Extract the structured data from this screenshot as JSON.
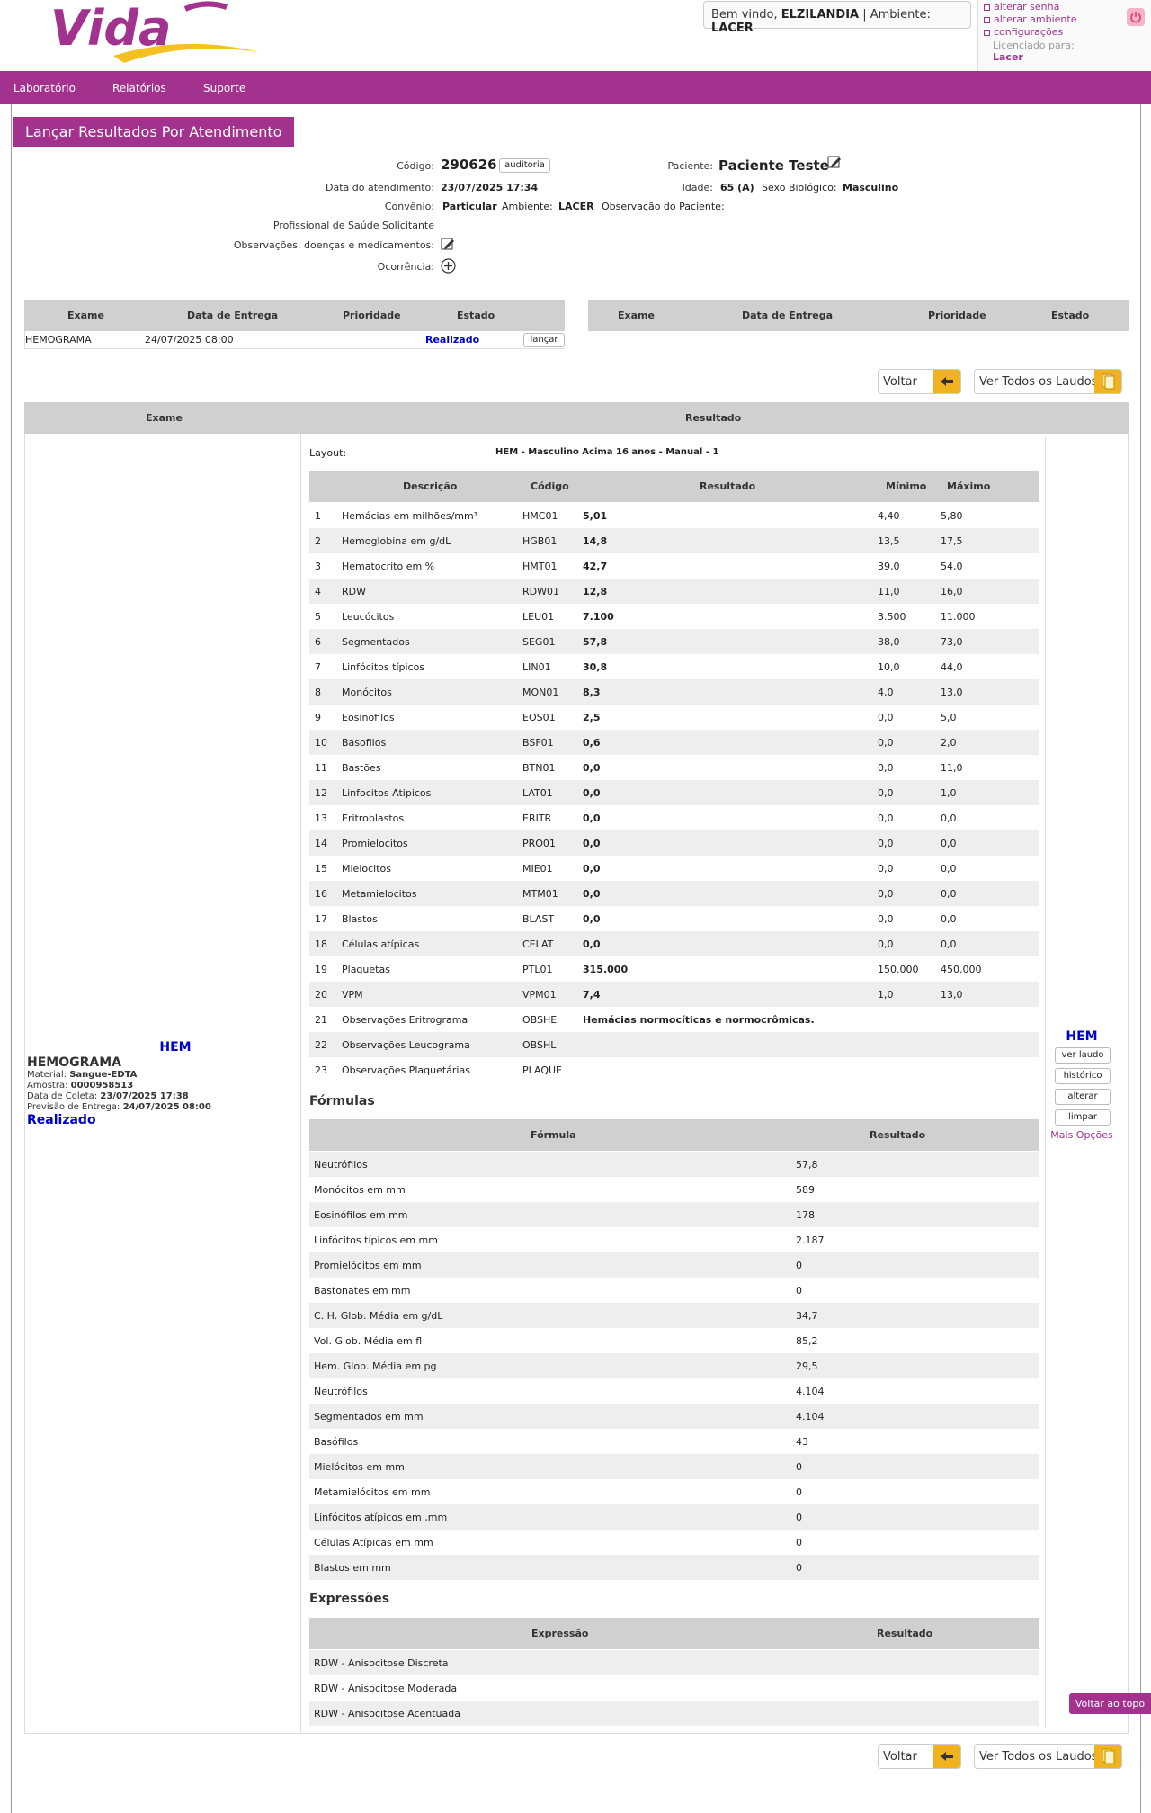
{
  "header": {
    "welcome_prefix": "Bem vindo,",
    "user": "ELZILANDIA",
    "env_prefix": "| Ambiente:",
    "env": "LACER",
    "links": [
      "alterar senha",
      "alterar ambiente",
      "configurações"
    ],
    "licensed_label": "Licenciado para:",
    "licensed_to": "Lacer"
  },
  "nav": [
    "Laboratório",
    "Relatórios",
    "Suporte"
  ],
  "page_title": "Lançar Resultados Por Atendimento",
  "info": {
    "codigo_label": "Código:",
    "codigo": "290626",
    "auditoria_btn": "auditoria",
    "data_label": "Data do atendimento:",
    "data": "23/07/2025 17:34",
    "convenio_label": "Convênio:",
    "convenio": "Particular",
    "ambiente_label": "Ambiente:",
    "ambiente": "LACER",
    "obs_paciente_label": "Observação do Paciente:",
    "profissional_label": "Profissional de Saúde Solicitante",
    "observacoes_label": "Observações, doenças e medicamentos:",
    "ocorrencia_label": "Ocorrência:",
    "paciente_label": "Paciente:",
    "paciente": "Paciente Teste",
    "idade_label": "Idade:",
    "idade": "65 (A)",
    "sexo_label": "Sexo Biológico:",
    "sexo": "Masculino"
  },
  "exam_table": {
    "headers": [
      "Exame",
      "Data de Entrega",
      "Prioridade",
      "Estado"
    ],
    "row": {
      "exame": "HEMOGRAMA",
      "data": "24/07/2025 08:00",
      "estado": "Realizado",
      "btn": "lançar"
    }
  },
  "buttons": {
    "voltar": "Voltar",
    "ver_todos": "Ver Todos os Laudos",
    "voltar_topo": "Voltar ao topo"
  },
  "result_head": {
    "exame": "Exame",
    "resultado": "Resultado"
  },
  "exam_info": {
    "code": "HEM",
    "name": "HEMOGRAMA",
    "material_label": "Material:",
    "material": "Sangue-EDTA",
    "amostra_label": "Amostra:",
    "amostra": "0000958513",
    "coleta_label": "Data de Coleta:",
    "coleta": "23/07/2025 17:38",
    "previsao_label": "Previsão de Entrega:",
    "previsao": "24/07/2025 08:00",
    "status": "Realizado"
  },
  "layout": {
    "label": "Layout:",
    "value": "HEM - Masculino Acima 16 anos - Manual - 1"
  },
  "params_headers": [
    "Descrição",
    "Código",
    "Resultado",
    "Mínimo",
    "Máximo"
  ],
  "params": [
    {
      "n": "1",
      "desc": "Hemácias em milhões/mm³",
      "code": "HMC01",
      "res": "5,01",
      "min": "4,40",
      "max": "5,80"
    },
    {
      "n": "2",
      "desc": "Hemoglobina em g/dL",
      "code": "HGB01",
      "res": "14,8",
      "min": "13,5",
      "max": "17,5"
    },
    {
      "n": "3",
      "desc": "Hematocrito em %",
      "code": "HMT01",
      "res": "42,7",
      "min": "39,0",
      "max": "54,0"
    },
    {
      "n": "4",
      "desc": "RDW",
      "code": "RDW01",
      "res": "12,8",
      "min": "11,0",
      "max": "16,0"
    },
    {
      "n": "5",
      "desc": "Leucócitos",
      "code": "LEU01",
      "res": "7.100",
      "min": "3.500",
      "max": "11.000"
    },
    {
      "n": "6",
      "desc": "Segmentados",
      "code": "SEG01",
      "res": "57,8",
      "min": "38,0",
      "max": "73,0"
    },
    {
      "n": "7",
      "desc": "Linfócitos típicos",
      "code": "LIN01",
      "res": "30,8",
      "min": "10,0",
      "max": "44,0"
    },
    {
      "n": "8",
      "desc": "Monócitos",
      "code": "MON01",
      "res": "8,3",
      "min": "4,0",
      "max": "13,0"
    },
    {
      "n": "9",
      "desc": "Eosinofilos",
      "code": "EOS01",
      "res": "2,5",
      "min": "0,0",
      "max": "5,0"
    },
    {
      "n": "10",
      "desc": "Basofilos",
      "code": "BSF01",
      "res": "0,6",
      "min": "0,0",
      "max": "2,0"
    },
    {
      "n": "11",
      "desc": "Bastões",
      "code": "BTN01",
      "res": "0,0",
      "min": "0,0",
      "max": "11,0"
    },
    {
      "n": "12",
      "desc": "Linfocitos Atipicos",
      "code": "LAT01",
      "res": "0,0",
      "min": "0,0",
      "max": "1,0"
    },
    {
      "n": "13",
      "desc": "Eritroblastos",
      "code": "ERITR",
      "res": "0,0",
      "min": "0,0",
      "max": "0,0"
    },
    {
      "n": "14",
      "desc": "Promielocitos",
      "code": "PRO01",
      "res": "0,0",
      "min": "0,0",
      "max": "0,0"
    },
    {
      "n": "15",
      "desc": "Mielocitos",
      "code": "MIE01",
      "res": "0,0",
      "min": "0,0",
      "max": "0,0"
    },
    {
      "n": "16",
      "desc": "Metamielocitos",
      "code": "MTM01",
      "res": "0,0",
      "min": "0,0",
      "max": "0,0"
    },
    {
      "n": "17",
      "desc": "Blastos",
      "code": "BLAST",
      "res": "0,0",
      "min": "0,0",
      "max": "0,0"
    },
    {
      "n": "18",
      "desc": "Células atípicas",
      "code": "CELAT",
      "res": "0,0",
      "min": "0,0",
      "max": "0,0"
    },
    {
      "n": "19",
      "desc": "Plaquetas",
      "code": "PTL01",
      "res": "315.000",
      "min": "150.000",
      "max": "450.000"
    },
    {
      "n": "20",
      "desc": "VPM",
      "code": "VPM01",
      "res": "7,4",
      "min": "1,0",
      "max": "13,0"
    },
    {
      "n": "21",
      "desc": "Observações Eritrograma",
      "code": "OBSHE",
      "res": "Hemácias normocíticas e normocrômicas.",
      "min": "",
      "max": ""
    },
    {
      "n": "22",
      "desc": "Observações Leucograma",
      "code": "OBSHL",
      "res": "",
      "min": "",
      "max": ""
    },
    {
      "n": "23",
      "desc": "Observações Plaquetárias",
      "code": "PLAQUE",
      "res": "",
      "min": "",
      "max": ""
    }
  ],
  "formulas_title": "Fórmulas",
  "formulas_headers": [
    "Fórmula",
    "Resultado"
  ],
  "formulas": [
    {
      "name": "Neutrófilos",
      "res": "57,8"
    },
    {
      "name": "Monócitos em mm",
      "res": "589"
    },
    {
      "name": "Eosinófilos em mm",
      "res": "178"
    },
    {
      "name": "Linfócitos típicos em mm",
      "res": "2.187"
    },
    {
      "name": "Promielócitos em mm",
      "res": "0"
    },
    {
      "name": "Bastonates em mm",
      "res": "0"
    },
    {
      "name": "C. H. Glob. Média em g/dL",
      "res": "34,7"
    },
    {
      "name": "Vol. Glob. Média em fl",
      "res": "85,2"
    },
    {
      "name": "Hem. Glob. Média em pg",
      "res": "29,5"
    },
    {
      "name": "Neutrófilos",
      "res": "4.104"
    },
    {
      "name": "Segmentados em mm",
      "res": "4.104"
    },
    {
      "name": "Basófilos",
      "res": "43"
    },
    {
      "name": "Mielócitos em mm",
      "res": "0"
    },
    {
      "name": "Metamielócitos em mm",
      "res": "0"
    },
    {
      "name": "Linfócitos atípicos em ,mm",
      "res": "0"
    },
    {
      "name": "Células Atípicas em mm",
      "res": "0"
    },
    {
      "name": "Blastos em mm",
      "res": "0"
    }
  ],
  "expr_title": "Expressões",
  "expr_headers": [
    "Expressão",
    "Resultado"
  ],
  "expressions": [
    "RDW - Anisocitose Discreta",
    "RDW - Anisocitose Moderada",
    "RDW - Anisocitose Acentuada"
  ],
  "side": {
    "code": "HEM",
    "buttons": [
      "ver laudo",
      "histórico",
      "alterar",
      "limpar"
    ],
    "more": "Mais Opções"
  },
  "colors": {
    "brand": "#a3328f",
    "accent": "#f0b21f",
    "status_blue": "#0000cc"
  }
}
